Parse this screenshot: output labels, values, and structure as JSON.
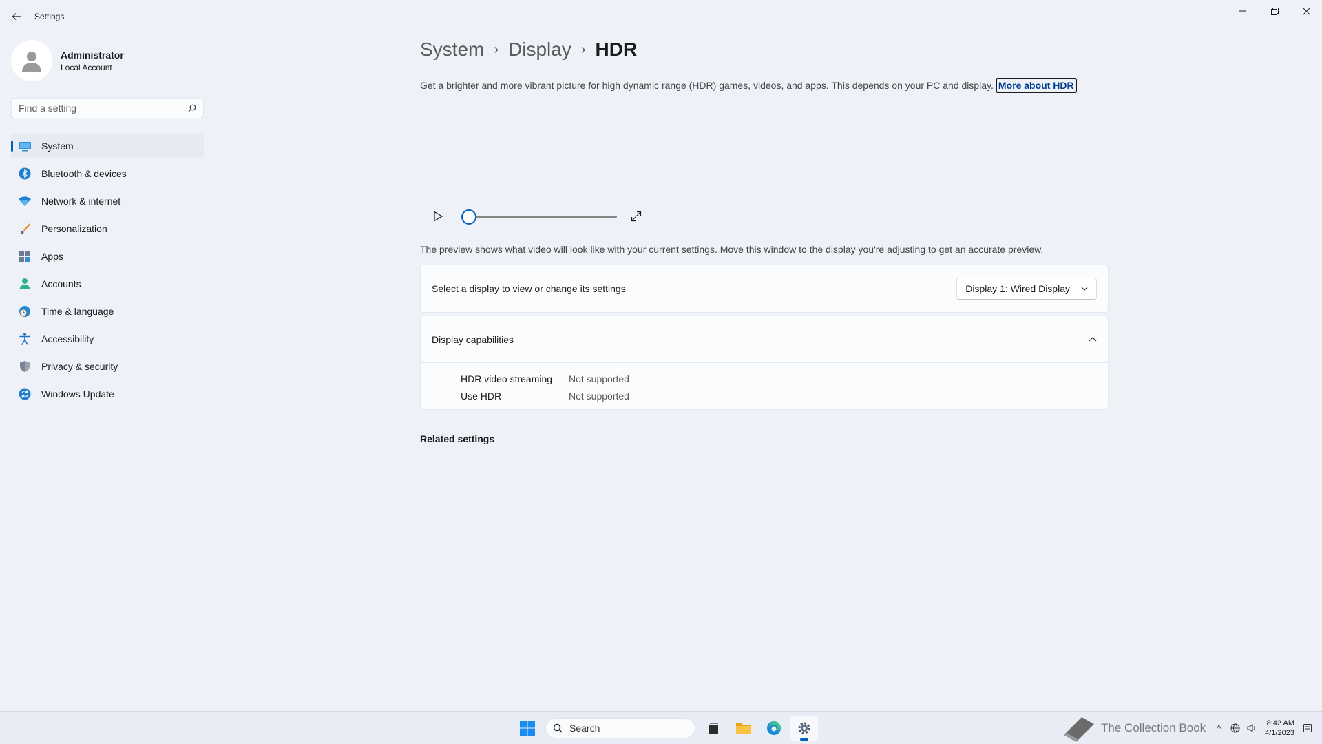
{
  "window": {
    "title": "Settings"
  },
  "profile": {
    "name": "Administrator",
    "account_type": "Local Account"
  },
  "search": {
    "placeholder": "Find a setting"
  },
  "sidebar": {
    "items": [
      {
        "label": "System",
        "icon": "system-icon",
        "active": true
      },
      {
        "label": "Bluetooth & devices",
        "icon": "bluetooth-icon"
      },
      {
        "label": "Network & internet",
        "icon": "wifi-icon"
      },
      {
        "label": "Personalization",
        "icon": "brush-icon"
      },
      {
        "label": "Apps",
        "icon": "apps-icon"
      },
      {
        "label": "Accounts",
        "icon": "accounts-icon"
      },
      {
        "label": "Time & language",
        "icon": "globe-clock-icon"
      },
      {
        "label": "Accessibility",
        "icon": "accessibility-icon"
      },
      {
        "label": "Privacy & security",
        "icon": "shield-icon"
      },
      {
        "label": "Windows Update",
        "icon": "update-icon"
      }
    ]
  },
  "breadcrumb": {
    "level1": "System",
    "level2": "Display",
    "current": "HDR"
  },
  "main": {
    "description": "Get a brighter and more vibrant picture for high dynamic range (HDR) games, videos, and apps. This depends on your PC and display.",
    "more_link": "More about HDR",
    "preview_note": "The preview shows what video will look like with your current settings. Move this window to the display you're adjusting to get an accurate preview.",
    "player_progress": 0,
    "display_select": {
      "label": "Select a display to view or change its settings",
      "value": "Display 1: Wired Display"
    },
    "capabilities": {
      "title": "Display capabilities",
      "expanded": true,
      "rows": [
        {
          "name": "HDR video streaming",
          "value": "Not supported"
        },
        {
          "name": "Use HDR",
          "value": "Not supported"
        }
      ]
    },
    "related_title": "Related settings"
  },
  "taskbar": {
    "search_label": "Search",
    "watermark": "The Collection Book",
    "time": "8:42 AM",
    "date": "4/1/2023"
  },
  "colors": {
    "accent": "#005fb8",
    "background": "#eef2f8"
  }
}
